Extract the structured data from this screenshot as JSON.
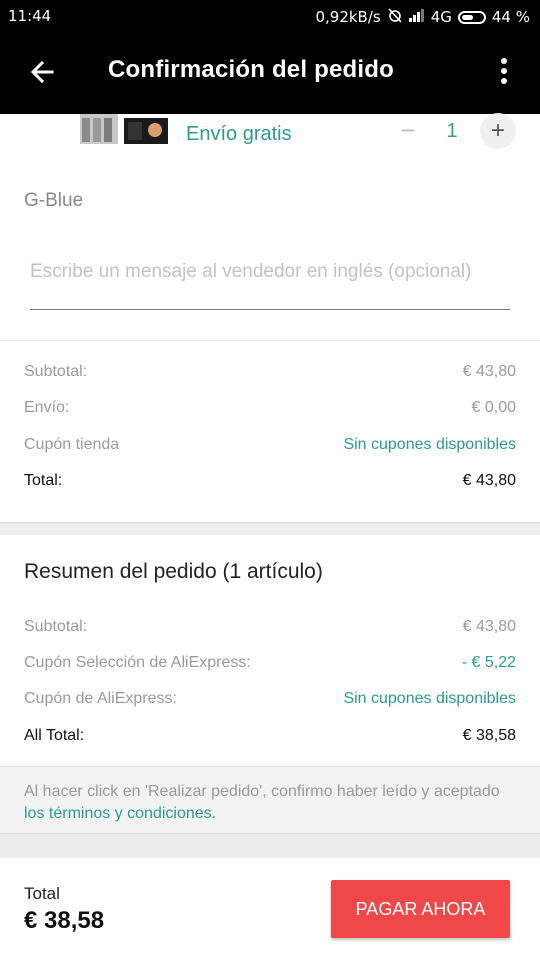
{
  "status_bar": {
    "time": "11:44",
    "network_speed": "0,92kB/s",
    "network_type": "4G",
    "battery": "44 %",
    "icons": [
      "alarm-off-icon",
      "signal-icon",
      "battery-icon"
    ]
  },
  "app_bar": {
    "title": "Confirmación del pedido",
    "back_icon": "back-arrow-icon",
    "menu_icon": "more-vert-icon"
  },
  "product": {
    "shipping": "Envío gratis",
    "quantity": "1",
    "minus": "−",
    "plus": "+",
    "seller": "G-Blue",
    "message_placeholder": "Escribe un mensaje al vendedor en inglés (opcional)"
  },
  "store_totals": {
    "subtotal_label": "Subtotal:",
    "subtotal_value": "€ 43,80",
    "shipping_label": "Envío:",
    "shipping_value": "€ 0,00",
    "coupon_label": "Cupón tienda",
    "coupon_value": "Sin cupones disponibles",
    "total_label": "Total:",
    "total_value": "€ 43,80"
  },
  "summary": {
    "title": "Resumen del pedido (1 artículo)",
    "subtotal_label": "Subtotal:",
    "subtotal_value": "€ 43,80",
    "selection_coupon_label": "Cupón Selección de AliExpress:",
    "selection_coupon_value": "- € 5,22",
    "ali_coupon_label": "Cupón de AliExpress:",
    "ali_coupon_value": "Sin cupones disponibles",
    "all_total_label": "All Total:",
    "all_total_value": "€ 38,58"
  },
  "terms": {
    "text": "Al hacer click en 'Realizar pedido', confirmo haber leído y aceptado ",
    "link": "los términos y condiciones",
    "end": "."
  },
  "footer": {
    "total_label": "Total",
    "total_value": "€ 38,58",
    "pay_button": "PAGAR AHORA"
  },
  "colors": {
    "accent": "#2a9a94",
    "pay_button": "#f04848",
    "app_bar": "#000000"
  }
}
